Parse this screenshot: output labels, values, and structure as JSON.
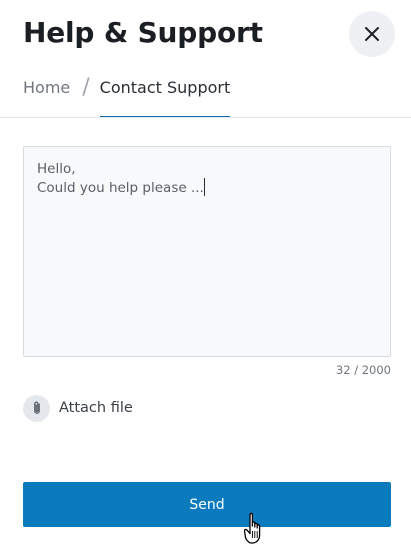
{
  "header": {
    "title": "Help & Support",
    "close_icon": "close-icon"
  },
  "breadcrumb": {
    "home": "Home",
    "separator": "/",
    "current": "Contact Support"
  },
  "message": {
    "value": "Hello,\nCould you help please ...",
    "char_count": "32 / 2000"
  },
  "attach": {
    "icon": "paperclip-icon",
    "label": "Attach file"
  },
  "send": {
    "label": "Send"
  },
  "colors": {
    "accent": "#0b7bbd",
    "tab_underline": "#0b6fb0",
    "close_bg": "#eef0f4",
    "field_bg": "#f8f9fb"
  }
}
